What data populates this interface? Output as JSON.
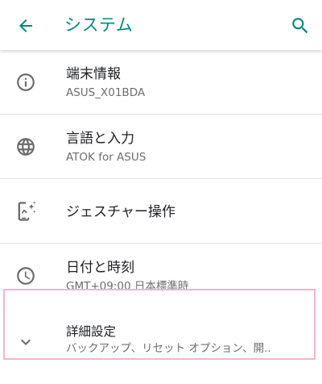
{
  "app_bar": {
    "title": "システム",
    "back_icon": "arrow-back-icon",
    "search_icon": "search-icon"
  },
  "colors": {
    "accent": "#00897b",
    "icon_gray": "#6b6b6b",
    "highlight": "#f2b3cf"
  },
  "items": [
    {
      "title": "端末情報",
      "subtitle": "ASUS_X01BDA",
      "icon": "info-icon"
    },
    {
      "title": "言語と入力",
      "subtitle": "ATOK for ASUS",
      "icon": "globe-icon"
    },
    {
      "title": "ジェスチャー操作",
      "icon": "gesture-phone-icon"
    },
    {
      "title": "日付と時刻",
      "subtitle": "GMT+09:00 日本標準時",
      "icon": "clock-icon"
    },
    {
      "title": "詳細設定",
      "subtitle": "バックアップ、リセット オプション、開..",
      "icon": "chevron-down-icon"
    }
  ]
}
